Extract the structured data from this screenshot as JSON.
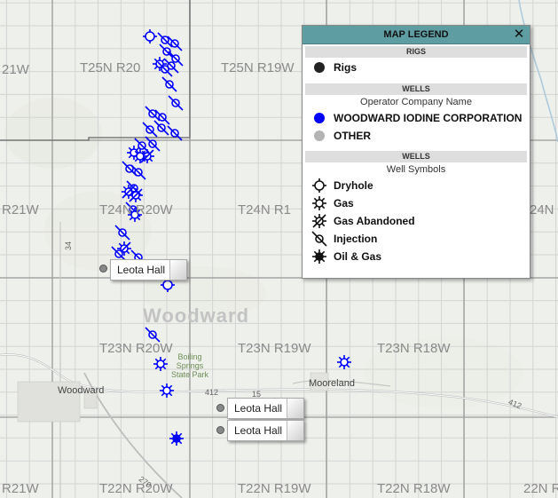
{
  "legend": {
    "title": "MAP LEGEND",
    "rigs_section": "RIGS",
    "rigs_label": "Rigs",
    "wells_section_1": "WELLS",
    "operator_subtitle": "Operator Company Name",
    "operators": [
      {
        "label": "WOODWARD IODINE CORPORATION",
        "color": "#0000ff"
      },
      {
        "label": "OTHER",
        "color": "#b4b4b4"
      }
    ],
    "wells_section_2": "WELLS",
    "symbols_subtitle": "Well Symbols",
    "symbols": [
      {
        "label": "Dryhole",
        "icon": "dryhole-icon"
      },
      {
        "label": "Gas",
        "icon": "gas-icon"
      },
      {
        "label": "Gas Abandoned",
        "icon": "gas-abandoned-icon"
      },
      {
        "label": "Injection",
        "icon": "injection-icon"
      },
      {
        "label": "Oil & Gas",
        "icon": "oil-gas-icon"
      }
    ]
  },
  "map": {
    "county": "Woodward",
    "township_labels": [
      "21W",
      "T25N R20",
      "T25N R19W",
      "R21W",
      "T24N R20W",
      "T24N R1",
      "24N R",
      "T23N R20W",
      "T23N R19W",
      "T23N R18W",
      "R21W",
      "T22N R20W",
      "T22N R19W",
      "T22N R18W",
      "22N R"
    ],
    "places": [
      "Woodward",
      "Mooreland"
    ],
    "park": "Boiling Springs State Park",
    "park_lines": [
      "Boiling",
      "Springs",
      "State Park"
    ],
    "highways": [
      "412",
      "15",
      "412",
      "34",
      "270"
    ],
    "callouts": [
      "Leota Hall",
      "Leota Hall",
      "Leota Hall"
    ],
    "well_color": "#0000ff"
  }
}
